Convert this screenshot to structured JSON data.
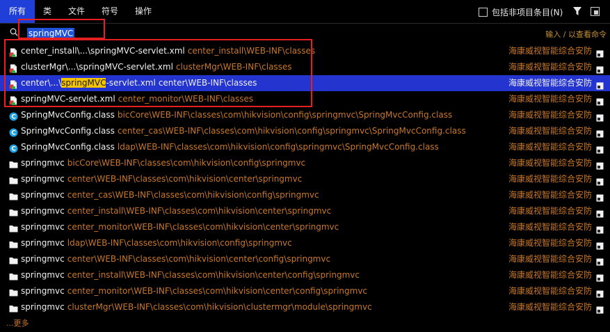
{
  "tabs": [
    {
      "label": "所有",
      "active": true
    },
    {
      "label": "类",
      "active": false
    },
    {
      "label": "文件",
      "active": false
    },
    {
      "label": "符号",
      "active": false
    },
    {
      "label": "操作",
      "active": false
    }
  ],
  "include_option": {
    "label": "包括非项目条目(N)",
    "checked": false
  },
  "search": {
    "query": "springMVC",
    "hint": "输入 / 以查看命令"
  },
  "results": [
    {
      "icon": "xml-file-icon",
      "name": "center_install\\...\\springMVC-servlet.xml",
      "path": "center_install\\WEB-INF\\classes",
      "module": "海康威视智能综合安防"
    },
    {
      "icon": "xml-file-icon",
      "name": "clusterMgr\\...\\springMVC-servlet.xml",
      "path": "clusterMgr\\WEB-INF\\classes",
      "module": "海康威视智能综合安防"
    },
    {
      "icon": "xml-file-icon",
      "name_pre": "center\\...\\",
      "name_hl": "springMVC",
      "name_post": "-servlet.xml",
      "path": "center\\WEB-INF\\classes",
      "module": "海康威视智能综合安防",
      "selected": true
    },
    {
      "icon": "xml-file-icon",
      "name": "springMVC-servlet.xml",
      "path": "center_monitor\\WEB-INF\\classes",
      "module": "海康威视智能综合安防"
    },
    {
      "icon": "class-icon",
      "name": "SpringMvcConfig.class",
      "path": "bicCore\\WEB-INF\\classes\\com\\hikvision\\config\\springmvc\\SpringMvcConfig.class",
      "module": "海康威视智能综合安防"
    },
    {
      "icon": "class-icon",
      "name": "SpringMvcConfig.class",
      "path": "center_cas\\WEB-INF\\classes\\com\\hikvision\\config\\springmvc\\SpringMvcConfig.class",
      "module": "海康威视智能综合安防"
    },
    {
      "icon": "class-icon",
      "name": "SpringMvcConfig.class",
      "path": "ldap\\WEB-INF\\classes\\com\\hikvision\\config\\springmvc\\SpringMvcConfig.class",
      "module": "海康威视智能综合安防"
    },
    {
      "icon": "folder-icon",
      "name": "springmvc",
      "path": "bicCore\\WEB-INF\\classes\\com\\hikvision\\config\\springmvc",
      "module": "海康威视智能综合安防"
    },
    {
      "icon": "folder-icon",
      "name": "springmvc",
      "path": "center\\WEB-INF\\classes\\com\\hikvision\\center\\springmvc",
      "module": "海康威视智能综合安防"
    },
    {
      "icon": "folder-icon",
      "name": "springmvc",
      "path": "center_cas\\WEB-INF\\classes\\com\\hikvision\\config\\springmvc",
      "module": "海康威视智能综合安防"
    },
    {
      "icon": "folder-icon",
      "name": "springmvc",
      "path": "center_install\\WEB-INF\\classes\\com\\hikvision\\center\\springmvc",
      "module": "海康威视智能综合安防"
    },
    {
      "icon": "folder-icon",
      "name": "springmvc",
      "path": "center_monitor\\WEB-INF\\classes\\com\\hikvision\\center\\springmvc",
      "module": "海康威视智能综合安防"
    },
    {
      "icon": "folder-icon",
      "name": "springmvc",
      "path": "ldap\\WEB-INF\\classes\\com\\hikvision\\config\\springmvc",
      "module": "海康威视智能综合安防"
    },
    {
      "icon": "folder-icon",
      "name": "springmvc",
      "path": "center\\WEB-INF\\classes\\com\\hikvision\\center\\config\\springmvc",
      "module": "海康威视智能综合安防"
    },
    {
      "icon": "folder-icon",
      "name": "springmvc",
      "path": "center_install\\WEB-INF\\classes\\com\\hikvision\\center\\config\\springmvc",
      "module": "海康威视智能综合安防"
    },
    {
      "icon": "folder-icon",
      "name": "springmvc",
      "path": "center_monitor\\WEB-INF\\classes\\com\\hikvision\\center\\config\\springmvc",
      "module": "海康威视智能综合安防"
    },
    {
      "icon": "folder-icon",
      "name": "springmvc",
      "path": "clusterMgr\\WEB-INF\\classes\\com\\hikvision\\clustermgr\\module\\springmvc",
      "module": "海康威视智能综合安防"
    }
  ],
  "more_label": "...更多",
  "colors": {
    "accent": "#1f3fd8",
    "selection": "#2434cf",
    "path": "#c8782a",
    "highlight": "#f5c400",
    "annotation": "#e62020"
  }
}
